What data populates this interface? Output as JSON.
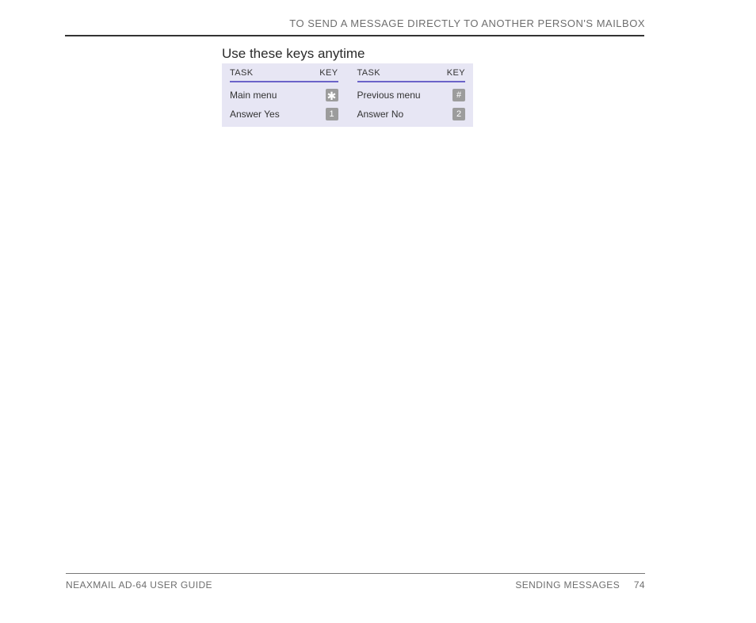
{
  "header": {
    "title": "TO SEND A MESSAGE DIRECTLY TO ANOTHER PERSON'S MAILBOX"
  },
  "section": {
    "title": "Use these keys anytime"
  },
  "table": {
    "left": {
      "task_header": "TASK",
      "key_header": "KEY",
      "rows": [
        {
          "task": "Main menu",
          "key": "✱"
        },
        {
          "task": "Answer Yes",
          "key": "1"
        }
      ]
    },
    "right": {
      "task_header": "TASK",
      "key_header": "KEY",
      "rows": [
        {
          "task": "Previous menu",
          "key": "#"
        },
        {
          "task": "Answer No",
          "key": "2"
        }
      ]
    }
  },
  "footer": {
    "left": "NEAXMAIL AD-64 USER GUIDE",
    "right_section": "SENDING MESSAGES",
    "page_number": "74"
  }
}
